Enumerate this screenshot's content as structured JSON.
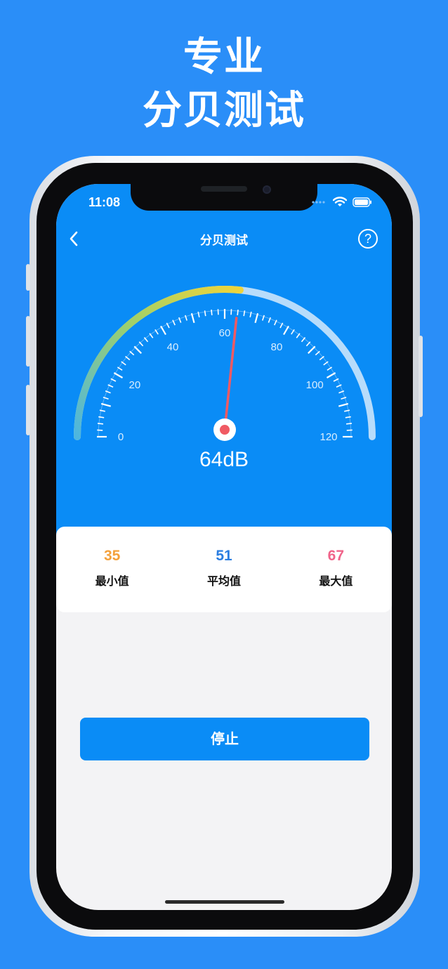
{
  "promo": {
    "line1": "专业",
    "line2": "分贝测试"
  },
  "status_bar": {
    "time": "11:08",
    "icons": [
      "signal-icon",
      "wifi-icon",
      "battery-icon"
    ]
  },
  "nav": {
    "title": "分贝测试",
    "back_icon": "back-chevron-icon",
    "help_label": "?"
  },
  "gauge": {
    "min": 0,
    "max": 120,
    "value": 64,
    "tick_labels": [
      "0",
      "20",
      "40",
      "60",
      "80",
      "100",
      "120"
    ],
    "track_color": "#b7dcfb",
    "fill_colors": [
      "#4db6e0",
      "#9fd06a",
      "#f0d43a"
    ],
    "needle_color": "#f05a63"
  },
  "reading": {
    "text": "64dB"
  },
  "stats": {
    "min": {
      "value": "35",
      "label": "最小值",
      "color": "#f4a13c"
    },
    "avg": {
      "value": "51",
      "label": "平均值",
      "color": "#2a7de1"
    },
    "max": {
      "value": "67",
      "label": "最大值",
      "color": "#f0648a"
    }
  },
  "action": {
    "stop_label": "停止"
  },
  "colors": {
    "background": "#2a8ef8",
    "app_blue": "#0a8cf6"
  }
}
